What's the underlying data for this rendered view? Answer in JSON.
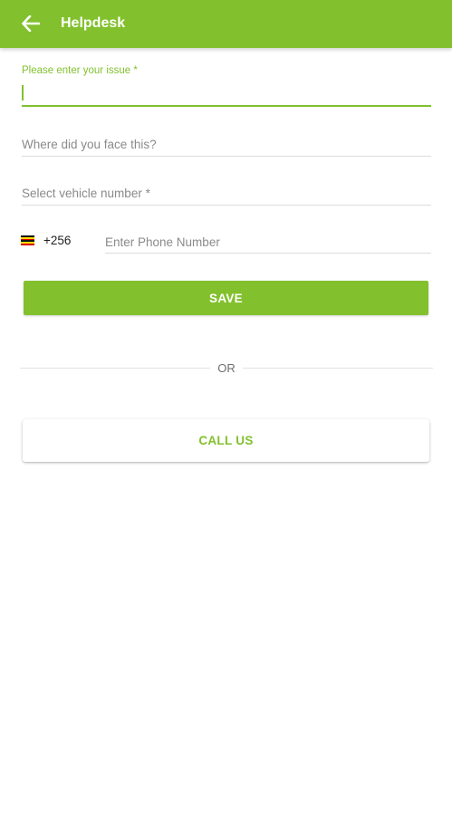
{
  "appbar": {
    "title": "Helpdesk",
    "back_icon": "arrow-left-icon",
    "color": "#82c12d"
  },
  "form": {
    "issue": {
      "label": "Please enter your issue *",
      "value": ""
    },
    "location": {
      "placeholder": "Where did you face this?"
    },
    "vehicle": {
      "placeholder": "Select vehicle number *"
    },
    "phone": {
      "country_flag_icon": "uganda-flag-icon",
      "dial_code": "+256",
      "placeholder": "Enter Phone Number"
    },
    "save_label": "SAVE"
  },
  "divider": {
    "text": "OR"
  },
  "call": {
    "label": "CALL US"
  }
}
